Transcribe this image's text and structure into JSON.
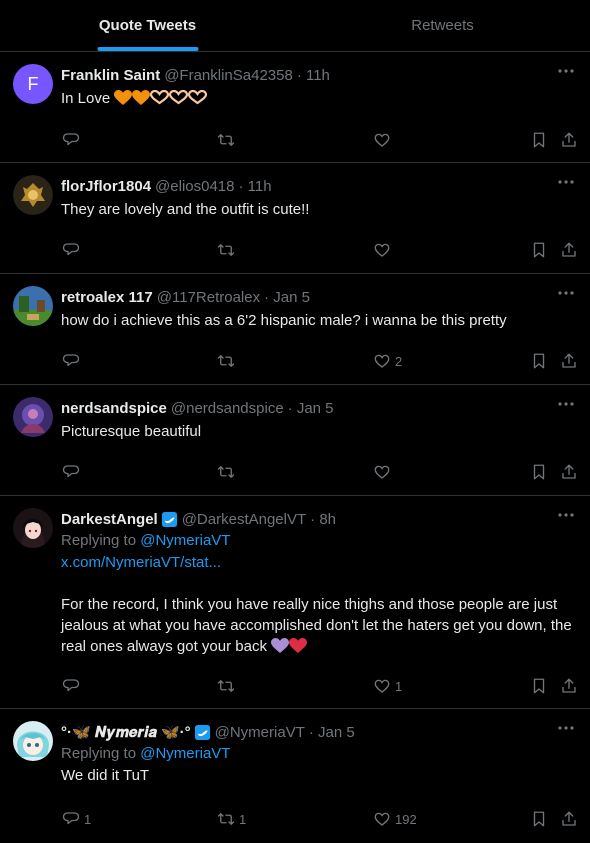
{
  "tabs": [
    {
      "label": "Quote Tweets"
    },
    {
      "label": "Retweets"
    }
  ],
  "tweets": [
    {
      "name": "Franklin Saint",
      "handle": "@FranklinSa42358",
      "time": "· 11h",
      "avatar_letter": "F",
      "text": "In Love",
      "replies": "",
      "retweets": "",
      "likes": ""
    },
    {
      "name": "florJflor1804",
      "handle": "@elios0418",
      "time": "· 11h",
      "text": "They are lovely and the outfit is cute!!",
      "replies": "",
      "retweets": "",
      "likes": ""
    },
    {
      "name": "retroalex 117",
      "handle": "@117Retroalex",
      "time": "· Jan 5",
      "text": "how do i achieve this as a 6'2 hispanic male? i wanna be this pretty",
      "replies": "",
      "retweets": "",
      "likes": "2"
    },
    {
      "name": "nerdsandspice",
      "handle": "@nerdsandspice",
      "time": "· Jan 5",
      "text": "Picturesque beautiful",
      "replies": "",
      "retweets": "",
      "likes": ""
    },
    {
      "name": "DarkestAngel",
      "handle": "@DarkestAngelVT",
      "time": "· 8h",
      "replying_prefix": "Replying to",
      "replying_to": "@NymeriaVT",
      "link": "x.com/NymeriaVT/stat...",
      "text": "For the record, I think you have really nice thighs and those people are just jealous at what you have accomplished don't let the haters get you down, the real ones always got your back",
      "replies": "",
      "retweets": "",
      "likes": "1"
    },
    {
      "name": "°·🦋 𝑵𝒚𝒎𝒆𝒓𝒊𝒂 🦋·°",
      "handle": "@NymeriaVT",
      "time": "· Jan 5",
      "replying_prefix": "Replying to",
      "replying_to": "@NymeriaVT",
      "text": "We did it TuT",
      "replies": "1",
      "retweets": "1",
      "likes": "192"
    }
  ],
  "colors": {
    "accent": "#1d9bf0",
    "muted": "#71767b",
    "border": "#2f3336",
    "orange_heart": "#f4900c",
    "purple_heart": "#aa8ed6",
    "red_heart": "#dd2e44"
  }
}
